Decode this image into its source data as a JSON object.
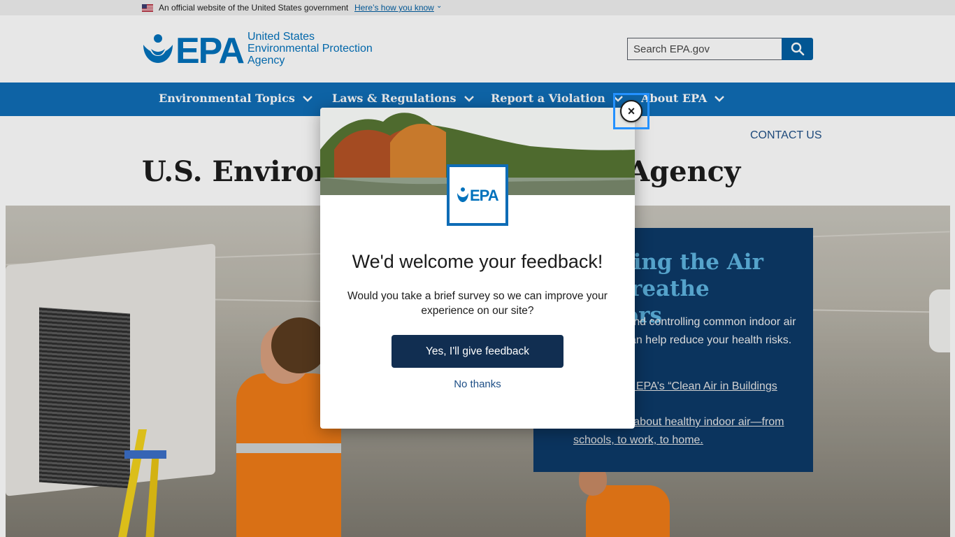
{
  "gov_banner": {
    "text": "An official website of the United States government",
    "link": "Here’s how you know"
  },
  "header": {
    "agency_line1": "United States",
    "agency_line2": "Environmental Protection",
    "agency_line3": "Agency",
    "logo_text": "EPA",
    "search": {
      "placeholder": "Search EPA.gov",
      "value": ""
    }
  },
  "nav": {
    "items": [
      {
        "label": "Environmental Topics"
      },
      {
        "label": "Laws & Regulations"
      },
      {
        "label": "Report a Violation"
      },
      {
        "label": "About EPA"
      }
    ]
  },
  "contact_label": "CONTACT US",
  "page_title": "U.S. Environmental Protection Agency",
  "hero_card": {
    "title": "Clearing the Air We Breathe Indoors",
    "body": "Identifying and controlling common indoor air pollutants can help reduce your health risks.",
    "link1": "Learn about EPA’s “Clean Air in Buildings Challenge”",
    "link2": "Learn more about healthy indoor air—from schools, to work, to home."
  },
  "modal": {
    "logo_text": "EPA",
    "title": "We'd welcome your feedback!",
    "text": "Would you take a brief survey so we can improve your experience on our site?",
    "yes_label": "Yes, I'll give feedback",
    "no_label": "No thanks",
    "close_label": "×"
  },
  "colors": {
    "nav_bg": "#0e6cb6",
    "card_bg": "#0b3867",
    "card_title": "#5db4e0",
    "button_bg": "#112e51",
    "focus_ring": "#2491ff"
  }
}
